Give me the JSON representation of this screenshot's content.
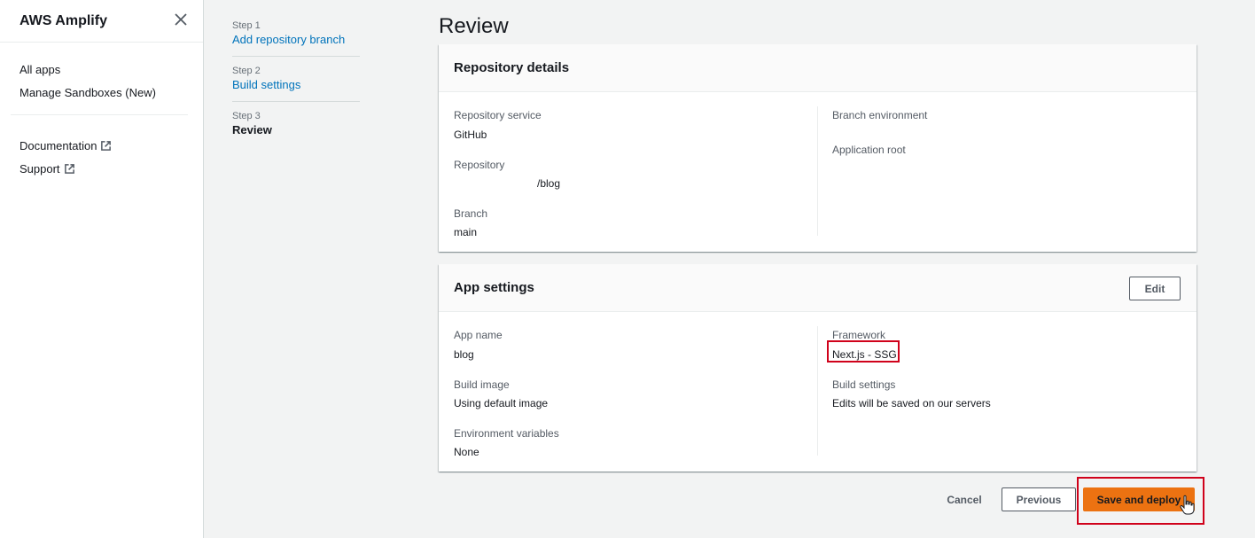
{
  "sidebar": {
    "title": "AWS Amplify",
    "nav_items": [
      {
        "label": "All apps"
      },
      {
        "label": "Manage Sandboxes (New)"
      }
    ],
    "external_items": [
      {
        "label": "Documentation",
        "icon": "external-link-icon"
      },
      {
        "label": "Support",
        "icon": "external-link-icon"
      }
    ]
  },
  "steps": [
    {
      "number": "Step 1",
      "label": "Add repository branch",
      "state": "link"
    },
    {
      "number": "Step 2",
      "label": "Build settings",
      "state": "link"
    },
    {
      "number": "Step 3",
      "label": "Review",
      "state": "current"
    }
  ],
  "page": {
    "title": "Review"
  },
  "repository_details": {
    "title": "Repository details",
    "left": [
      {
        "label": "Repository service",
        "value": "GitHub"
      },
      {
        "label": "Repository",
        "value": "/blog"
      },
      {
        "label": "Branch",
        "value": "main"
      }
    ],
    "right": [
      {
        "label": "Branch environment",
        "value": ""
      },
      {
        "label": "Application root",
        "value": ""
      }
    ]
  },
  "app_settings": {
    "title": "App settings",
    "edit_label": "Edit",
    "left": [
      {
        "label": "App name",
        "value": "blog"
      },
      {
        "label": "Build image",
        "value": "Using default image"
      },
      {
        "label": "Environment variables",
        "value": "None"
      }
    ],
    "right": [
      {
        "label": "Framework",
        "value": "Next.js - SSG"
      },
      {
        "label": "Build settings",
        "value": "Edits will be saved on our servers"
      }
    ]
  },
  "footer": {
    "cancel_label": "Cancel",
    "previous_label": "Previous",
    "deploy_label": "Save and deploy"
  },
  "colors": {
    "accent": "#ec7211",
    "link": "#0073bb",
    "highlight": "#d0021b"
  }
}
